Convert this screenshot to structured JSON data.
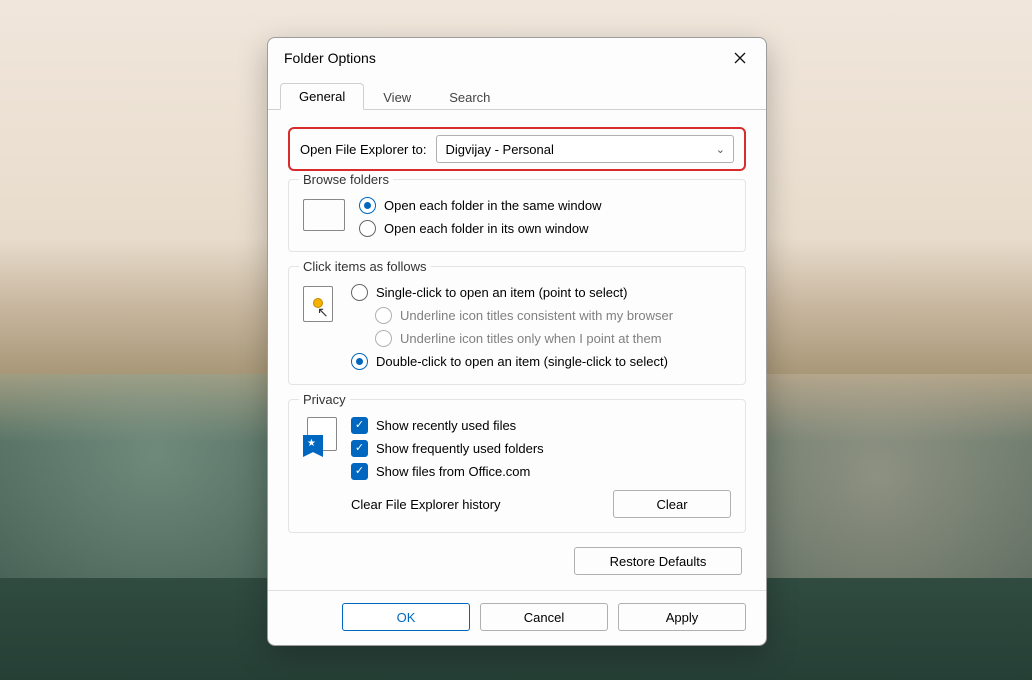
{
  "dialog": {
    "title": "Folder Options",
    "tabs": [
      {
        "label": "General",
        "active": true
      },
      {
        "label": "View",
        "active": false
      },
      {
        "label": "Search",
        "active": false
      }
    ],
    "open_to": {
      "label": "Open File Explorer to:",
      "value": "Digvijay - Personal"
    },
    "browse": {
      "title": "Browse folders",
      "opt_same": "Open each folder in the same window",
      "opt_own": "Open each folder in its own window"
    },
    "click": {
      "title": "Click items as follows",
      "single": "Single-click to open an item (point to select)",
      "underline_browser": "Underline icon titles consistent with my browser",
      "underline_point": "Underline icon titles only when I point at them",
      "double": "Double-click to open an item (single-click to select)"
    },
    "privacy": {
      "title": "Privacy",
      "recent": "Show recently used files",
      "frequent": "Show frequently used folders",
      "office": "Show files from Office.com",
      "clear_label": "Clear File Explorer history",
      "clear_button": "Clear"
    },
    "restore": "Restore Defaults",
    "buttons": {
      "ok": "OK",
      "cancel": "Cancel",
      "apply": "Apply"
    }
  }
}
